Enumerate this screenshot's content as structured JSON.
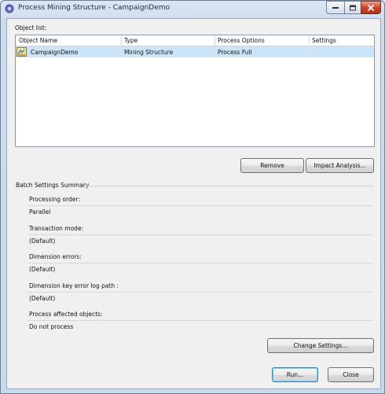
{
  "window": {
    "title": "Process Mining Structure - CampaignDemo"
  },
  "object_list": {
    "label": "Object list:",
    "columns": [
      "Object Name",
      "Type",
      "Process Options",
      "Settings"
    ],
    "rows": [
      {
        "name": "CampaignDemo",
        "type": "Mining Structure",
        "process_options": "Process Full",
        "settings": ""
      }
    ]
  },
  "buttons": {
    "remove": "Remove",
    "impact_analysis": "Impact Analysis...",
    "change_settings": "Change Settings...",
    "run": "Run...",
    "close": "Close"
  },
  "batch": {
    "heading": "Batch Settings Summary",
    "processing_order": {
      "label": "Processing order:",
      "value": "Parallel"
    },
    "transaction_mode": {
      "label": "Transaction mode:",
      "value": "(Default)"
    },
    "dimension_errors": {
      "label": "Dimension errors:",
      "value": "(Default)"
    },
    "dimension_key_error_log_path": {
      "label": "Dimension key error log path :",
      "value": "(Default)"
    },
    "process_affected_objects": {
      "label": "Process affected objects:",
      "value": "Do not process"
    }
  },
  "colors": {
    "selection": "#cce4f7",
    "close_button": "#c7482c",
    "default_button_border": "#3c7fb1"
  }
}
